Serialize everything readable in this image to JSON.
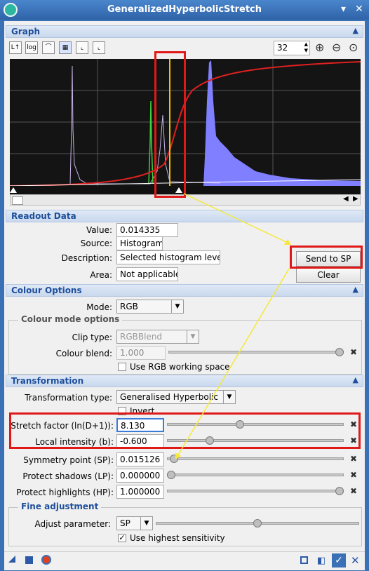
{
  "window": {
    "title": "GeneralizedHyperbolicStretch"
  },
  "graph": {
    "section_title": "Graph",
    "zoom_value": "32"
  },
  "readout": {
    "section_title": "Readout Data",
    "value_label": "Value:",
    "value": "0.014335",
    "source_label": "Source:",
    "source": "Histogram",
    "description_label": "Description:",
    "description": "Selected histogram level",
    "area_label": "Area:",
    "area": "Not applicable",
    "send_button": "Send to SP",
    "clear_button": "Clear"
  },
  "colour": {
    "section_title": "Colour Options",
    "mode_label": "Mode:",
    "mode": "RGB",
    "group_title": "Colour mode options",
    "clip_label": "Clip type:",
    "clip": "RGBBlend",
    "blend_label": "Colour blend:",
    "blend": "1.000",
    "blend_level": 1.0,
    "rgb_ws_label": "Use RGB working space",
    "rgb_ws_checked": false
  },
  "transformation": {
    "section_title": "Transformation",
    "type_label": "Transformation type:",
    "type": "Generalised Hyperbolic",
    "invert_label": "Invert",
    "invert_checked": false,
    "params": [
      {
        "label": "Stretch factor (ln(D+1)):",
        "value": "8.130",
        "level": 0.41
      },
      {
        "label": "Local intensity (b):",
        "value": "-0.600",
        "level": 0.23
      },
      {
        "label": "Symmetry point (SP):",
        "value": "0.015126",
        "level": 0.015
      },
      {
        "label": "Protect shadows (LP):",
        "value": "0.000000",
        "level": 0.0
      },
      {
        "label": "Protect highlights (HP):",
        "value": "1.000000",
        "level": 1.0
      }
    ]
  },
  "fine": {
    "group_title": "Fine adjustment",
    "adjust_label": "Adjust parameter:",
    "adjust": "SP",
    "adjust_level": 0.5,
    "sensitivity_label": "Use highest sensitivity",
    "sensitivity_checked": true,
    "check_mark": "✓"
  },
  "colors": {
    "accent": "#3a70b6",
    "highlight": "#e01818",
    "arrow": "#f5e83a",
    "curve": "#e02020",
    "histogram_blue": "#7f7fff"
  },
  "icons": {
    "collapse": "▲",
    "zoom_in": "⊕",
    "zoom_out": "⊖",
    "zoom_fit": "⊙",
    "reset": "✖",
    "close": "✕"
  }
}
